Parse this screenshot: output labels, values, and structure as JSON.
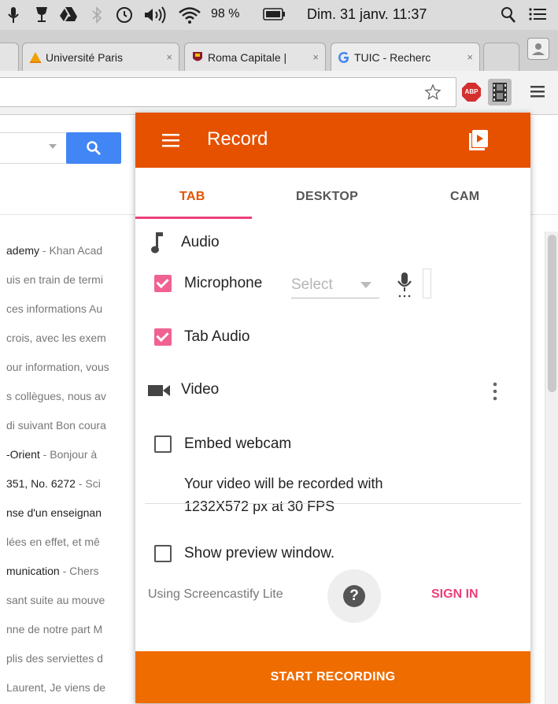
{
  "menubar": {
    "battery": "98 %",
    "datetime": "Dim. 31 janv. 11:37"
  },
  "tabs": [
    {
      "title": "Université Paris",
      "close": "×"
    },
    {
      "title": "Roma Capitale |",
      "close": "×"
    },
    {
      "title": "TUIC - Recherc",
      "close": "×"
    }
  ],
  "toolbar": {
    "adblock_label": "ABP"
  },
  "mail_list": [
    {
      "sender": "ademy",
      "snippet": " - Khan Acad"
    },
    {
      "sender": "",
      "snippet": "uis en train de termi"
    },
    {
      "sender": "",
      "snippet": "ces informations Au"
    },
    {
      "sender": "",
      "snippet": "crois, avec les exem"
    },
    {
      "sender": "",
      "snippet": "our information, vous"
    },
    {
      "sender": "",
      "snippet": "s collègues, nous av"
    },
    {
      "sender": "",
      "snippet": "di suivant Bon coura"
    },
    {
      "sender": "-Orient",
      "snippet": " - Bonjour à"
    },
    {
      "sender": "351, No. 6272",
      "snippet": " - Sci"
    },
    {
      "sender": "nse d'un enseignan",
      "snippet": ""
    },
    {
      "sender": "",
      "snippet": "lées en effet, et mê"
    },
    {
      "sender": "munication",
      "snippet": " - Chers"
    },
    {
      "sender": "",
      "snippet": "sant suite au mouve"
    },
    {
      "sender": "",
      "snippet": "nne de notre part M"
    },
    {
      "sender": "",
      "snippet": "plis des serviettes d"
    },
    {
      "sender": "",
      "snippet": "Laurent, Je viens de"
    }
  ],
  "popup": {
    "title": "Record",
    "tabs": {
      "tab": "TAB",
      "desktop": "DESKTOP",
      "cam": "CAM"
    },
    "audio_label": "Audio",
    "microphone_label": "Microphone",
    "microphone_select": "Select",
    "tab_audio_label": "Tab Audio",
    "video_label": "Video",
    "embed_webcam_label": "Embed webcam",
    "info_line1": "Your video will be recorded with",
    "info_line2": "1232X572 px at 30 FPS",
    "preview_label": "Show preview window.",
    "footer_text": "Using Screencastify Lite",
    "help_symbol": "?",
    "signin_label": "SIGN IN",
    "start_label": "START RECORDING",
    "checks": {
      "microphone": true,
      "tab_audio": true,
      "embed_webcam": false,
      "show_preview": false
    }
  },
  "colors": {
    "header": "#e65100",
    "accent": "#ec407a",
    "start": "#ef6c00",
    "search": "#4285f4"
  }
}
